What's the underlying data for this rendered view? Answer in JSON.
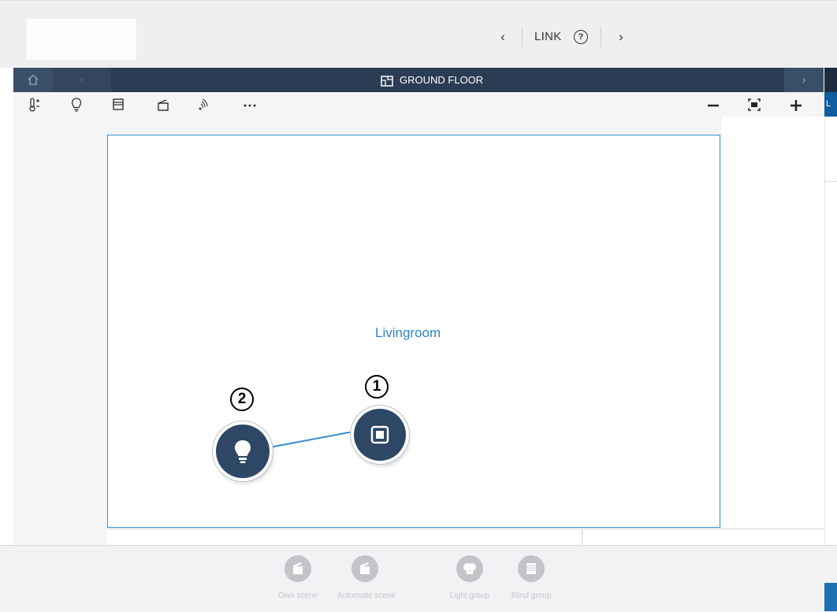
{
  "header": {
    "title": "LINK",
    "prev_glyph": "‹",
    "next_glyph": "›",
    "help_glyph": "?"
  },
  "floor_bar": {
    "title": "GROUND FLOOR",
    "back_glyph": "‹",
    "forward_glyph": "›"
  },
  "toolbar": {
    "tools": [
      "thermostat-icon",
      "bulb-icon",
      "blind-icon",
      "scene-icon",
      "wireless-icon",
      "more-icon"
    ],
    "zoom_out": "−",
    "zoom_in": "+"
  },
  "plan": {
    "room_name": "Livingroom",
    "markers": [
      "1",
      "2"
    ]
  },
  "bottom_bar": {
    "items": [
      {
        "label": "Own scene",
        "icon": "scene-icon"
      },
      {
        "label": "Automatic scene",
        "icon": "auto-scene-icon"
      },
      {
        "label": "Light group",
        "icon": "light-group-icon"
      },
      {
        "label": "Blind group",
        "icon": "blind-group-icon"
      }
    ]
  },
  "side_panel": {
    "tab_letter": "L"
  },
  "colors": {
    "accent": "#3a8fd1",
    "navy": "#2b3c55",
    "device": "#2d4764"
  }
}
